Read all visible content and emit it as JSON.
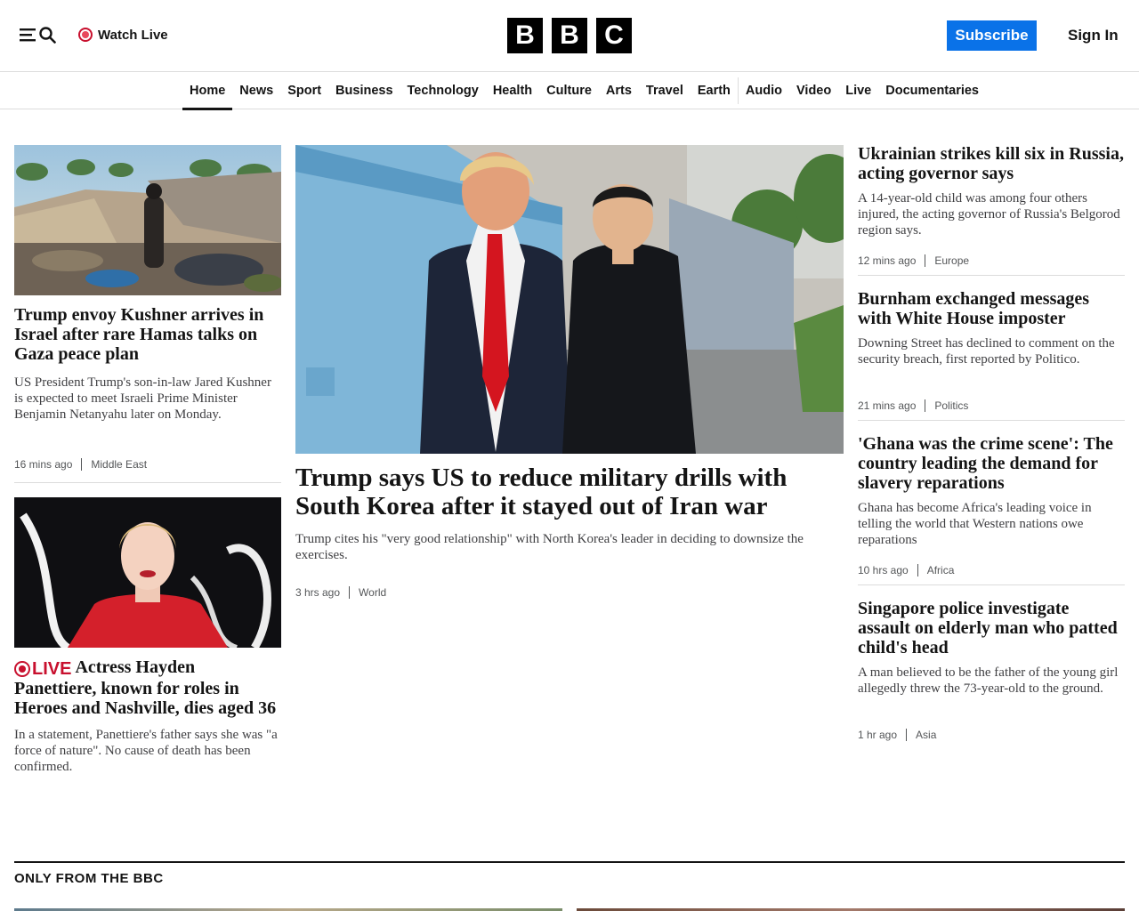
{
  "header": {
    "watch_live": "Watch Live",
    "logo_letters": [
      "B",
      "B",
      "C"
    ],
    "subscribe": "Subscribe",
    "sign_in": "Sign In"
  },
  "nav": {
    "items": [
      "Home",
      "News",
      "Sport",
      "Business",
      "Technology",
      "Health",
      "Culture",
      "Arts",
      "Travel",
      "Earth",
      "Audio",
      "Video",
      "Live",
      "Documentaries"
    ],
    "active": "Home"
  },
  "left": {
    "story1": {
      "headline": "Trump envoy Kushner arrives in Israel after rare Hamas talks on Gaza peace plan",
      "summary": "US President Trump's son-in-law Jared Kushner is expected to meet Israeli Prime Minister Benjamin Netanyahu later on Monday.",
      "time": "16 mins ago",
      "category": "Middle East"
    },
    "story2": {
      "live_label": "LIVE",
      "headline": "Actress Hayden Panettiere, known for roles in Heroes and Nashville, dies aged 36",
      "summary": "In a statement, Panettiere's father says she was \"a force of nature\". No cause of death has been confirmed."
    }
  },
  "main": {
    "headline": "Trump says US to reduce military drills with South Korea after it stayed out of Iran war",
    "summary": "Trump cites his \"very good relationship\" with North Korea's leader in deciding to downsize the exercises.",
    "time": "3 hrs ago",
    "category": "World"
  },
  "right": [
    {
      "headline": "Ukrainian strikes kill six in Russia, acting governor says",
      "summary": "A 14-year-old child was among four others injured, the acting governor of Russia's Belgorod region says.",
      "time": "12 mins ago",
      "category": "Europe"
    },
    {
      "headline": "Burnham exchanged messages with White House imposter",
      "summary": "Downing Street has declined to comment on the security breach, first reported by Politico.",
      "time": "21 mins ago",
      "category": "Politics"
    },
    {
      "headline": "'Ghana was the crime scene': The country leading the demand for slavery reparations",
      "summary": "Ghana has become Africa's leading voice in telling the world that Western nations owe reparations",
      "time": "10 hrs ago",
      "category": "Africa"
    },
    {
      "headline": "Singapore police investigate assault on elderly man who patted child's head",
      "summary": "A man believed to be the father of the young girl allegedly threw the 73-year-old to the ground.",
      "time": "1 hr ago",
      "category": "Asia"
    }
  ],
  "section": {
    "title": "ONLY FROM THE BBC"
  },
  "colors": {
    "brand_blue": "#0a72e8",
    "live_red": "#c8102e",
    "text": "#141414"
  },
  "icons": [
    "menu-icon",
    "search-icon",
    "live-dot-icon"
  ]
}
